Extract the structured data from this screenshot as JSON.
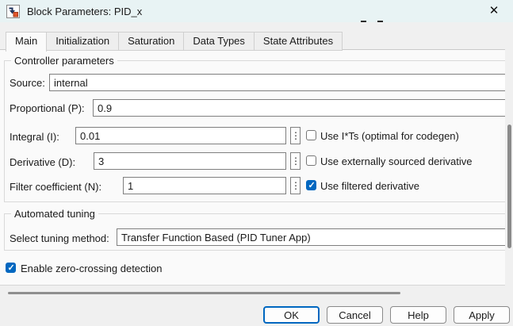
{
  "titlebar": {
    "title": "Block Parameters: PID_x"
  },
  "icons": {
    "close": "✕",
    "kebab": "⋮",
    "check": "✓",
    "block_icon": "simulink-block-icon"
  },
  "tabs": [
    {
      "label": "Main",
      "active": true
    },
    {
      "label": "Initialization",
      "active": false
    },
    {
      "label": "Saturation",
      "active": false
    },
    {
      "label": "Data Types",
      "active": false
    },
    {
      "label": "State Attributes",
      "active": false
    }
  ],
  "main": {
    "group1_legend": "Controller parameters",
    "source_label": "Source:",
    "source_value": "internal",
    "p_label": "Proportional (P):",
    "p_value": "0.9",
    "i_label": "Integral (I):",
    "i_value": "0.01",
    "i_check_label": "Use I*Ts (optimal for codegen)",
    "d_label": "Derivative (D):",
    "d_value": "3",
    "d_check_label": "Use externally sourced derivative",
    "n_label": "Filter coefficient (N):",
    "n_value": "1",
    "n_check_label": "Use filtered derivative",
    "group2_legend": "Automated tuning",
    "tune_label": "Select tuning method:",
    "tune_value": "Transfer Function Based (PID Tuner App)",
    "zc_label": "Enable zero-crossing detection"
  },
  "states": {
    "i_ts": false,
    "ext_derivative": false,
    "filtered_derivative": true,
    "zero_crossing": true
  },
  "buttons": {
    "ok": "OK",
    "cancel": "Cancel",
    "help": "Help",
    "apply": "Apply"
  },
  "colors": {
    "accent": "#0067c0",
    "titlebar": "#e8f3f4",
    "dialog": "#f0f0f0",
    "content": "#fafafa",
    "thumb": "#8b8b8b"
  }
}
